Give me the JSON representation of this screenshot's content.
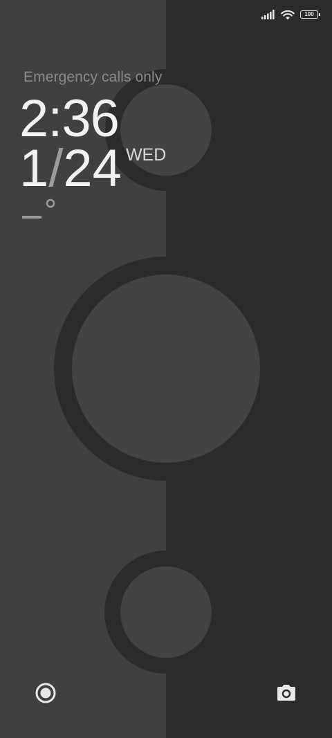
{
  "status_bar": {
    "signal_icon": "signal-bars-icon",
    "wifi_icon": "wifi-icon",
    "battery_level": "100"
  },
  "lockscreen": {
    "emergency_text": "Emergency calls only",
    "time": "2:36",
    "date_month": "1",
    "date_slash": "/",
    "date_day": "24",
    "weekday": "WED"
  },
  "bottom": {
    "left_icon": "voice-assistant-icon",
    "right_icon": "camera-icon"
  },
  "colors": {
    "left_panel": "#404040",
    "right_panel": "#2b2b2b",
    "ring": "#2b2b2b",
    "circle_fill": "#434343",
    "text_primary": "#f2f2f2",
    "text_secondary": "#8a8a8a"
  }
}
